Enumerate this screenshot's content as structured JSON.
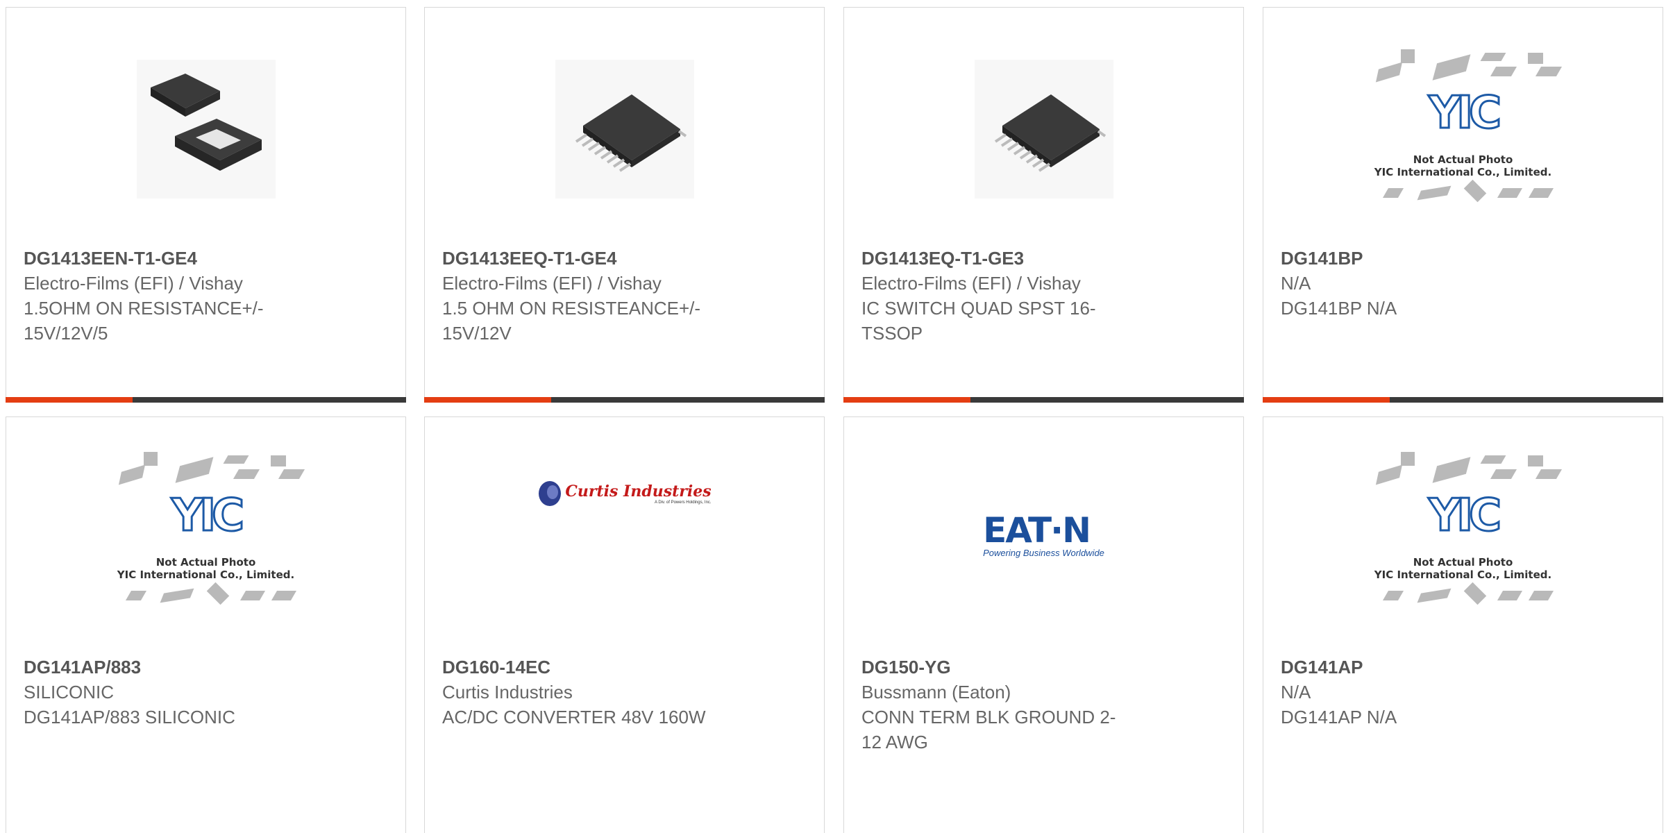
{
  "products": [
    {
      "part": "DG1413EEN-T1-GE4",
      "maker": "Electro-Films (EFI) / Vishay",
      "desc": [
        "1.5OHM ON RESISTANCE+/-",
        "15V/12V/5"
      ],
      "image": "qfn-package-photo"
    },
    {
      "part": "DG1413EEQ-T1-GE4",
      "maker": "Electro-Films (EFI) / Vishay",
      "desc": [
        "1.5 OHM ON RESISTEANCE+/-",
        "15V/12V"
      ],
      "image": "tssop-package-photo"
    },
    {
      "part": "DG1413EQ-T1-GE3",
      "maker": "Electro-Films (EFI) / Vishay",
      "desc": [
        "IC SWITCH QUAD SPST 16-",
        "TSSOP"
      ],
      "image": "tssop-package-photo"
    },
    {
      "part": "DG141BP",
      "maker": "N/A",
      "desc": [
        "DG141BP N/A"
      ],
      "image": "yic-placeholder"
    },
    {
      "part": "DG141AP/883",
      "maker": "SILICONIC",
      "desc": [
        "DG141AP/883 SILICONIC"
      ],
      "image": "yic-placeholder"
    },
    {
      "part": "DG160-14EC",
      "maker": "Curtis Industries",
      "desc": [
        "AC/DC CONVERTER 48V 160W"
      ],
      "image": "curtis-logo"
    },
    {
      "part": "DG150-YG",
      "maker": "Bussmann (Eaton)",
      "desc": [
        "CONN TERM BLK GROUND 2-",
        "12 AWG"
      ],
      "image": "eaton-logo"
    },
    {
      "part": "DG141AP",
      "maker": "N/A",
      "desc": [
        "DG141AP N/A"
      ],
      "image": "yic-placeholder"
    }
  ],
  "placeholder": {
    "letters": "YIC",
    "line1": "Not Actual Photo",
    "line2": "YIC International Co., Limited."
  },
  "curtis": {
    "name": "Curtis Industries",
    "sub": "A Div. of Powers Holdings, Inc."
  },
  "eaton": {
    "name": "EAT·N",
    "tagline": "Powering Business Worldwide"
  },
  "colors": {
    "accent": "#e43d12",
    "bar": "#3a3a3a",
    "text": "#555555"
  }
}
